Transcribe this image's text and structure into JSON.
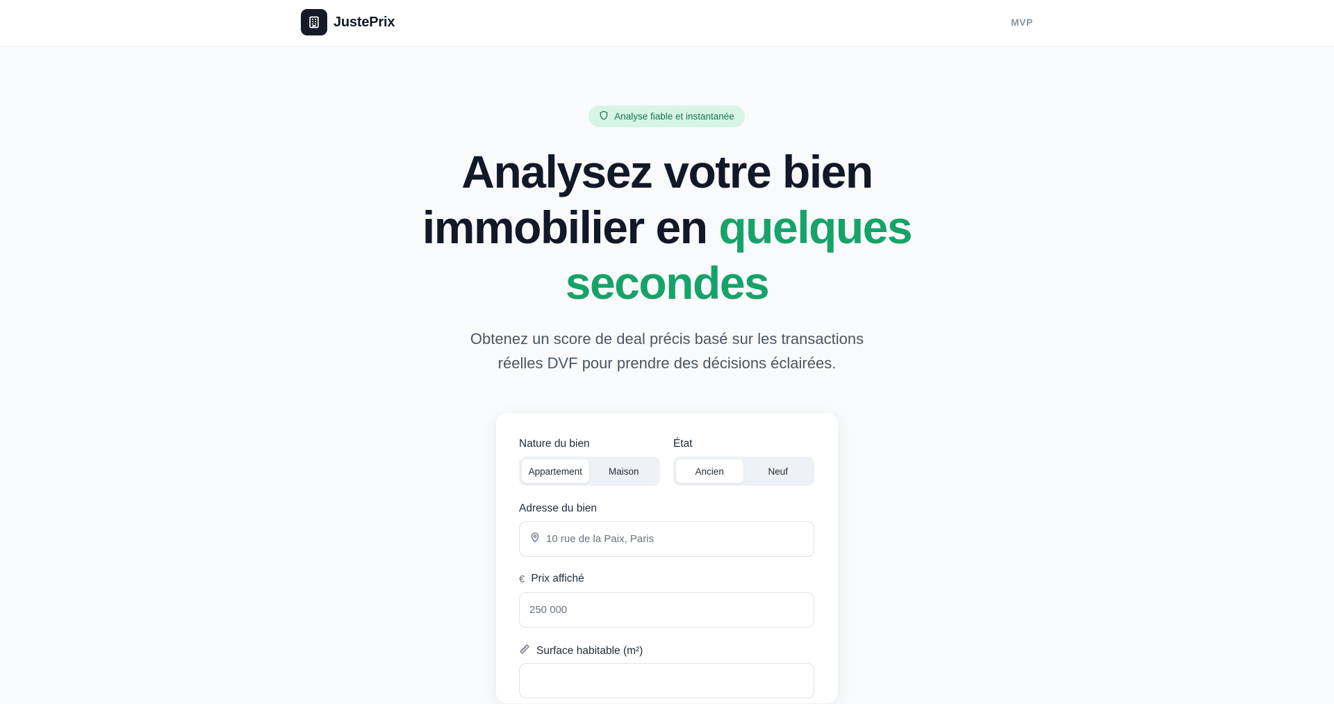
{
  "header": {
    "brand_name": "JustePrix",
    "mvp_label": "MVP"
  },
  "hero": {
    "badge_text": "Analyse fiable et instantanée",
    "title_line1": "Analysez votre bien",
    "title_line2_plain": "immobilier en ",
    "title_line2_accent": "quelques",
    "title_line3_accent": "secondes",
    "subtitle_line1": "Obtenez un score de deal précis basé sur les transactions",
    "subtitle_line2": "réelles DVF pour prendre des décisions éclairées."
  },
  "form": {
    "nature": {
      "label": "Nature du bien",
      "options": [
        "Appartement",
        "Maison"
      ],
      "selected": "Appartement"
    },
    "etat": {
      "label": "État",
      "options": [
        "Ancien",
        "Neuf"
      ],
      "selected": "Ancien"
    },
    "address": {
      "label": "Adresse du bien",
      "placeholder": "10 rue de la Paix, Paris"
    },
    "price": {
      "label": "Prix affiché",
      "placeholder": "250 000"
    },
    "surface": {
      "label": "Surface habitable (m²)"
    }
  },
  "colors": {
    "accent": "#16a36a",
    "badge_bg": "#d7f5e6",
    "logo_bg": "#141a26"
  },
  "icons": {
    "logo": "building-icon",
    "badge": "shield-icon",
    "address": "map-pin-icon",
    "price": "euro-icon",
    "surface": "ruler-icon"
  }
}
